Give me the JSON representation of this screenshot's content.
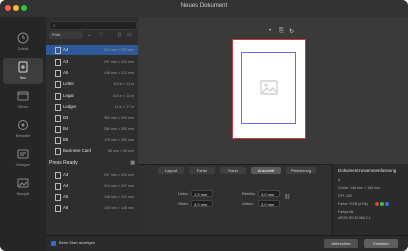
{
  "window": {
    "title": "Neues Dokument"
  },
  "rail": [
    {
      "label": "Zuletzt",
      "icon": "clock-icon"
    },
    {
      "label": "Neu",
      "icon": "new-document-icon"
    },
    {
      "label": "Öffnen",
      "icon": "folder-icon"
    },
    {
      "label": "Beispiele",
      "icon": "sample-icon"
    },
    {
      "label": "Vorlagen",
      "icon": "template-icon"
    },
    {
      "label": "Beispiel",
      "icon": "example-icon"
    }
  ],
  "list": {
    "filter": "Print",
    "groups": [
      {
        "title": "",
        "items": [
          {
            "name": "A4",
            "dims": "210 mm × 297 mm"
          },
          {
            "name": "A3",
            "dims": "297 mm × 420 mm"
          },
          {
            "name": "A5",
            "dims": "148 mm × 210 mm"
          },
          {
            "name": "Letter",
            "dims": "8,5 in × 11 in"
          },
          {
            "name": "Legal",
            "dims": "8,5 in × 14 in"
          },
          {
            "name": "Ledger",
            "dims": "11 in × 17 in"
          },
          {
            "name": "B3",
            "dims": "353 mm × 500 mm"
          },
          {
            "name": "B4",
            "dims": "250 mm × 353 mm"
          },
          {
            "name": "B5",
            "dims": "176 mm × 250 mm"
          },
          {
            "name": "Business Card",
            "dims": "85 mm × 55 mm"
          }
        ]
      },
      {
        "title": "Press Ready",
        "items": [
          {
            "name": "A3",
            "dims": "297 mm × 420 mm"
          },
          {
            "name": "A4",
            "dims": "210 mm × 297 mm"
          },
          {
            "name": "A5",
            "dims": "148 mm × 210 mm"
          },
          {
            "name": "A6",
            "dims": "105 mm × 148 mm"
          }
        ]
      }
    ]
  },
  "panel": {
    "tabs": [
      "Layout",
      "Farbe",
      "Rand",
      "Anschnitt",
      "Platzierung"
    ],
    "active_tab": "Anschnitt",
    "fields": [
      {
        "label": "Links:",
        "value": "1,5 mm"
      },
      {
        "label": "Oben:",
        "value": "3,0 mm"
      },
      {
        "label": "Rechts:",
        "value": "3,0 mm"
      },
      {
        "label": "Unten:",
        "value": "3,0 mm"
      }
    ]
  },
  "info": {
    "title": "Dokumentzusammenfassung",
    "lines": [
      "A",
      "Größe: 148 mm × 180 mm",
      "DPI: 300",
      "Farbe: RGB (8 Bit)",
      "Farbprofil:",
      "sRGB IEC61966-2.1"
    ]
  },
  "footer": {
    "start_label": "Beim Start anzeigen",
    "cancel": "Abbrechen",
    "create": "Erstellen"
  },
  "colors": {
    "selection": "#2e5a9a",
    "bleed": "#c83a3a",
    "margin": "#6a6ad8"
  }
}
